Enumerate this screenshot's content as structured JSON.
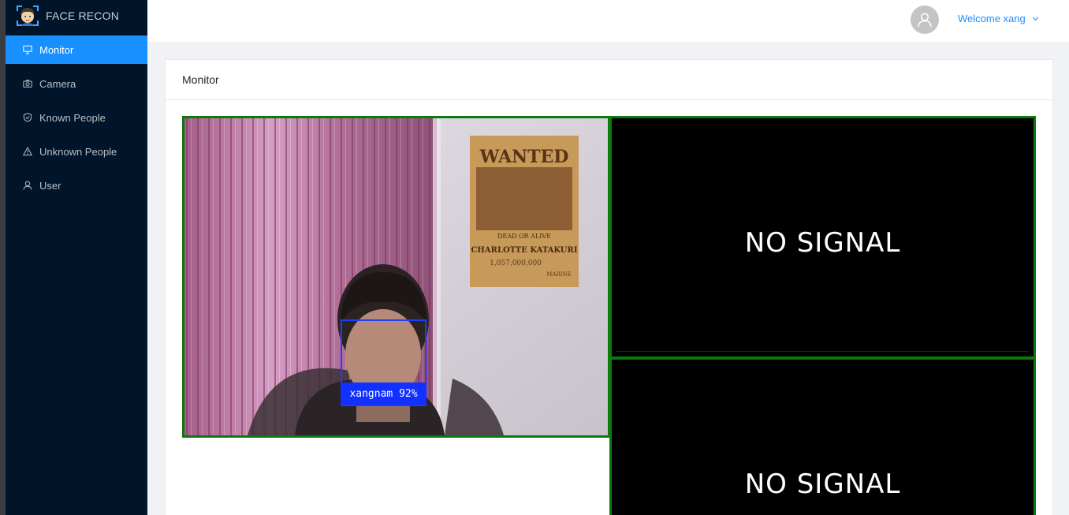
{
  "app": {
    "title": "FACE RECON"
  },
  "sidebar": {
    "items": [
      {
        "label": "Monitor",
        "icon": "monitor-icon",
        "active": true
      },
      {
        "label": "Camera",
        "icon": "camera-icon",
        "active": false
      },
      {
        "label": "Known People",
        "icon": "shield-check-icon",
        "active": false
      },
      {
        "label": "Unknown People",
        "icon": "warning-icon",
        "active": false
      },
      {
        "label": "User",
        "icon": "user-icon",
        "active": false
      }
    ]
  },
  "header": {
    "welcome": "Welcome xang",
    "avatar_icon": "user-avatar-icon"
  },
  "card": {
    "title": "Monitor"
  },
  "cameras": [
    {
      "status": "live",
      "detection": {
        "label": "xangnam 92%"
      },
      "poster_text": [
        "WANTED",
        "DEAD OR ALIVE",
        "CHARLOTTE KATAKURI",
        "1,057,000,000",
        "MARINE"
      ]
    },
    {
      "status": "no-signal",
      "text": "NO SIGNAL"
    },
    {
      "status": "no-signal",
      "text": "NO SIGNAL"
    }
  ],
  "colors": {
    "sidebar_bg": "#001529",
    "accent": "#1890ff",
    "camera_border": "#0c7a0c",
    "detection_box": "#1f3dff"
  }
}
